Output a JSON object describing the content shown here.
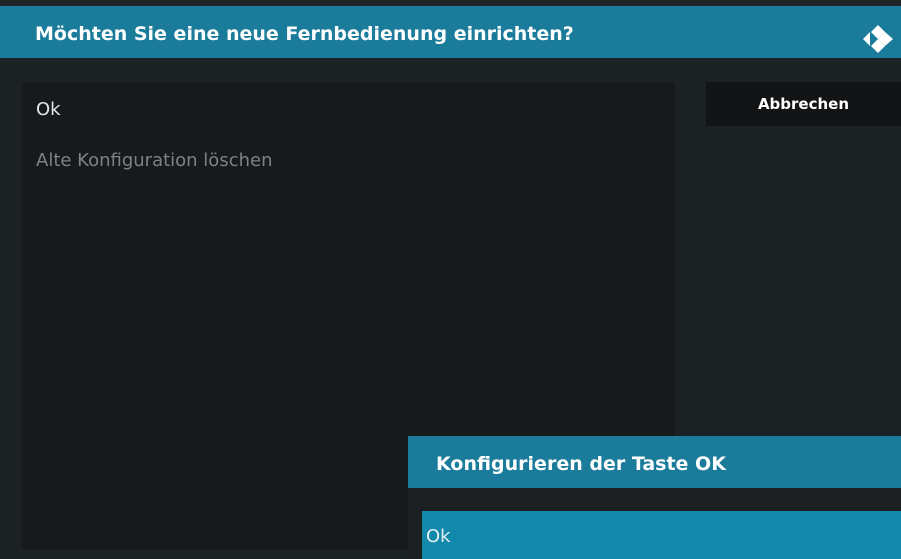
{
  "dialog": {
    "title": "Möchten Sie eine neue Fernbedienung einrichten?",
    "logo_icon": "kodi-logo-icon",
    "items": [
      {
        "label": "Ok"
      },
      {
        "label": "Alte Konfiguration löschen"
      }
    ],
    "cancel_label": "Abbrechen"
  },
  "sub_dialog": {
    "title": "Konfigurieren der Taste OK",
    "item_label": "Ok"
  },
  "colors": {
    "header": "#1a7c9a",
    "background": "#1c2124",
    "list_background": "#171a1b",
    "selected_item": "#1289ab"
  }
}
